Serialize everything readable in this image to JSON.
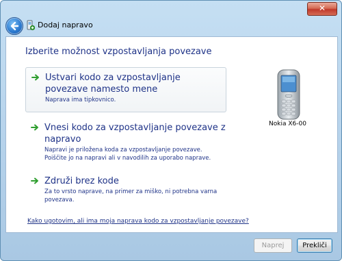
{
  "window": {
    "title": "Dodaj napravo",
    "close_label": "✕"
  },
  "main": {
    "heading": "Izberite možnost vzpostavljanja povezave",
    "options": [
      {
        "title": "Ustvari kodo za vzpostavljanje povezave namesto mene",
        "desc": [
          "Naprava ima tipkovnico."
        ]
      },
      {
        "title": "Vnesi kodo za vzpostavljanje povezave z napravo",
        "desc": [
          "Napravi je priložena koda za vzpostavljanje povezave.",
          "Poiščite jo na napravi ali v navodilih za uporabo naprave."
        ]
      },
      {
        "title": "Združi brez kode",
        "desc": [
          "Za to vrsto naprave, na primer za miško, ni potrebna varna",
          "povezava."
        ]
      }
    ],
    "device_name": "Nokia X6-00",
    "help_link": "Kako ugotovim, ali ima moja naprava kodo za vzpostavljanje povezave?"
  },
  "footer": {
    "next_label": "Naprej",
    "cancel_label": "Prekliči"
  },
  "icons": {
    "back": "back-arrow-icon",
    "bluetooth_device": "add-device-icon",
    "option_arrow": "green-arrow-icon",
    "phone": "mobile-phone-icon"
  },
  "colors": {
    "link_blue": "#1e3287",
    "arrow_green": "#2f9e2f",
    "frame_blue": "#b4d1ea"
  }
}
